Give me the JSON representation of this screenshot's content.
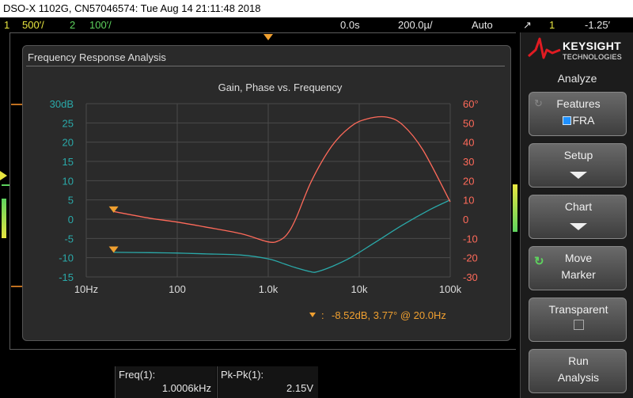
{
  "title_bar": "DSO-X 1102G, CN57046574: Tue Aug 14 21:11:48 2018",
  "status": {
    "ch1_num": "1",
    "ch1_scale": "500′/",
    "ch2_num": "2",
    "ch2_scale": "100′/",
    "time_delay": "0.0s",
    "time_scale": "200.0µ/",
    "trigger_mode": "Auto",
    "trigger_channel": "1",
    "trigger_level": "-1.25′"
  },
  "dialog": {
    "title": "Frequency Response Analysis"
  },
  "chart_data": {
    "type": "line",
    "title": "Gain, Phase vs. Frequency",
    "x_scale": "log",
    "xlim": [
      10,
      100000
    ],
    "x_tick_labels": [
      "10Hz",
      "100",
      "1.0k",
      "10k",
      "100k"
    ],
    "x_ticks": [
      10,
      100,
      1000,
      10000,
      100000
    ],
    "y_left": {
      "ylim": [
        -15,
        30
      ],
      "ticks": [
        30,
        25,
        20,
        15,
        10,
        5,
        0,
        -5,
        -10,
        -15
      ],
      "tick_labels": [
        "30dB",
        "25",
        "20",
        "15",
        "10",
        "5",
        "0",
        "-5",
        "-10",
        "-15"
      ]
    },
    "y_right": {
      "ylim": [
        -30,
        60
      ],
      "ticks": [
        60,
        50,
        40,
        30,
        20,
        10,
        0,
        -10,
        -20,
        -30
      ],
      "tick_labels": [
        "60°",
        "50",
        "40",
        "30",
        "20",
        "10",
        "0",
        "-10",
        "-20",
        "-30"
      ]
    },
    "grid": true,
    "series": [
      {
        "axis": "left",
        "color": "#2aa9a9",
        "x": [
          20,
          50,
          100,
          200,
          500,
          1000,
          1500,
          2000,
          3000,
          3500,
          5000,
          8000,
          15000,
          30000,
          60000,
          100000
        ],
        "y": [
          -8.6,
          -8.7,
          -8.8,
          -9.0,
          -9.3,
          -10.3,
          -11.6,
          -12.6,
          -13.7,
          -13.6,
          -12.3,
          -10.0,
          -6.0,
          -1.5,
          2.5,
          5.0
        ]
      },
      {
        "axis": "right",
        "color": "#ff6a5a",
        "x": [
          20,
          50,
          100,
          200,
          500,
          1000,
          1300,
          1600,
          2000,
          3000,
          5000,
          8000,
          12000,
          20000,
          30000,
          50000,
          100000
        ],
        "y": [
          4,
          0.5,
          -1.5,
          -4,
          -7.5,
          -11.8,
          -11.2,
          -8,
          0,
          20,
          38,
          48,
          52,
          53,
          49,
          36,
          9
        ]
      }
    ],
    "marker": {
      "text": "-8.52dB, 3.77° @ 20.0Hz",
      "x": 20,
      "gain": -8.52,
      "phase": 3.77
    }
  },
  "sidebar": {
    "logo_line1": "KEYSIGHT",
    "logo_line2": "TECHNOLOGIES",
    "menu_title": "Analyze",
    "keys": [
      {
        "line1": "Features",
        "line2": "FRA"
      },
      {
        "line1": "Setup"
      },
      {
        "line1": "Chart"
      },
      {
        "line1": "Move",
        "line2": "Marker"
      },
      {
        "line1": "Transparent"
      },
      {
        "line1": "Run",
        "line2": "Analysis"
      }
    ]
  },
  "measurements": [
    {
      "label": "Freq(1):",
      "value": "1.0006kHz"
    },
    {
      "label": "Pk-Pk(1):",
      "value": "2.15V"
    }
  ]
}
